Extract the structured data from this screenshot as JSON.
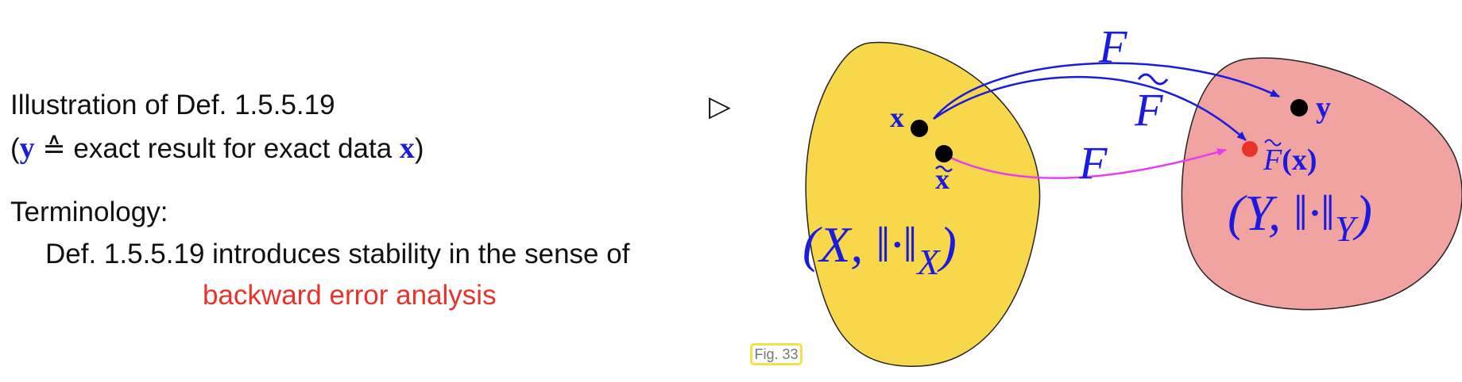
{
  "text": {
    "line1": "Illustration of Def. 1.5.5.19",
    "line2_open": "(",
    "line2_y": "y",
    "line2_mid": " ≙ exact result for exact data ",
    "line2_x": "x",
    "line2_close": ")",
    "terminology": "Terminology:",
    "def_line": "Def. 1.5.5.19 introduces stability in the sense of",
    "term": "backward error analysis",
    "pointer": "▷"
  },
  "figure": {
    "label": "Fig. 33",
    "domain_label_main": "(X, ‖·‖",
    "domain_sub": "X",
    "domain_close": ")",
    "range_label_main": "(Y, ‖·‖",
    "range_sub": "Y",
    "range_close": ")",
    "point_x": "x",
    "point_x_tilde": "x",
    "point_y": "y",
    "map_F_top": "F",
    "map_F_tilde": "F",
    "map_F_bottom": "F",
    "ftilde_x_F": "F",
    "ftilde_x_arg": "(x)"
  },
  "colors": {
    "domain_fill": "#f6d84a",
    "range_fill": "#f0a3a1",
    "math_blue": "#1a1ae0",
    "arrow_magenta": "#e83cf0",
    "red_point": "#e8322a",
    "term_red": "#e8322a"
  }
}
